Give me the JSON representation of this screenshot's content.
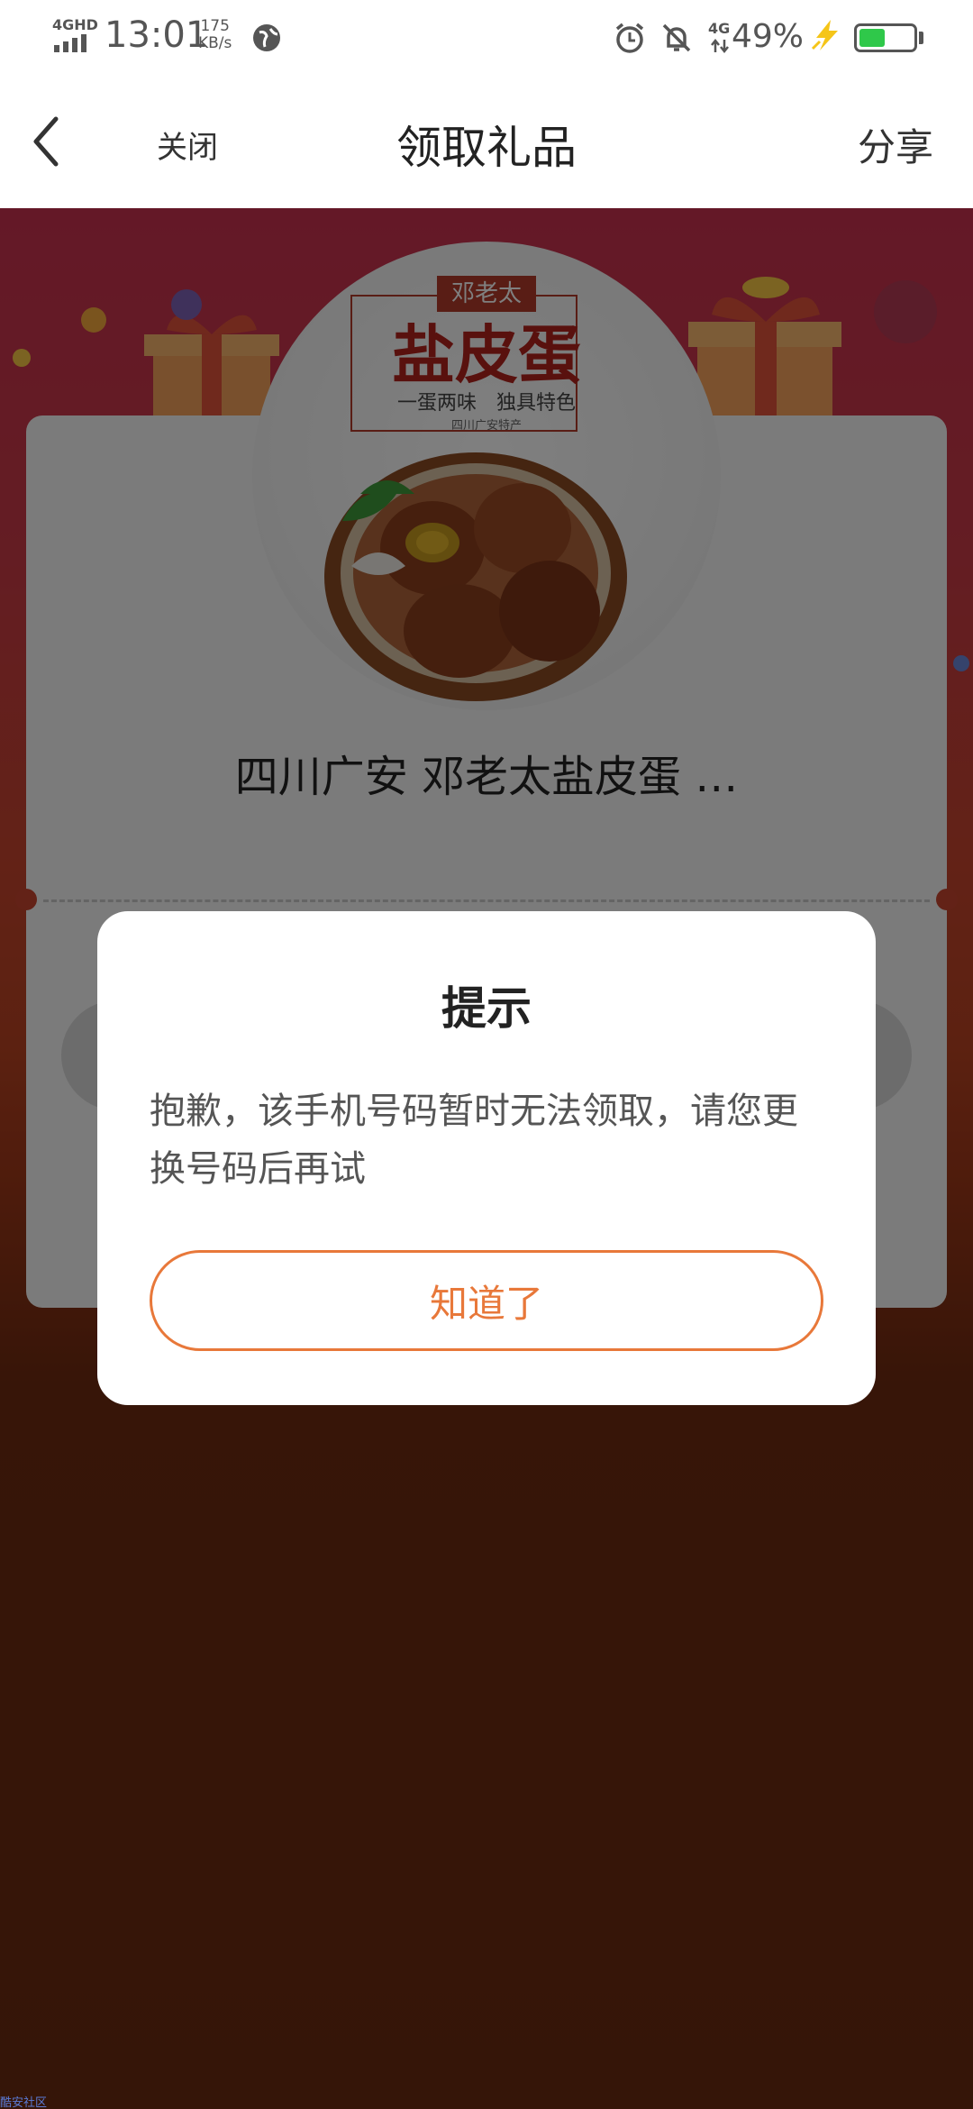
{
  "status_bar": {
    "network": "4GHD",
    "time": "13:01",
    "speed_value": "175",
    "speed_unit": "KB/s",
    "data_type": "4G",
    "battery_percent": "49%",
    "battery_level": 0.49,
    "battery_color": "#2fc84a"
  },
  "nav": {
    "back_icon": "chevron-left-icon",
    "close_label": "关闭",
    "title": "领取礼品",
    "share_label": "分享"
  },
  "product": {
    "brand": "邓老太",
    "name_art": "盐皮蛋",
    "slogan": "一蛋两味　独具特色",
    "origin": "四川广安特产",
    "title": "四川广安 邓老太盐皮蛋 …"
  },
  "dialog": {
    "title": "提示",
    "message": "抱歉，该手机号码暂时无法领取，请您更换号码后再试",
    "confirm_label": "知道了",
    "accent_color": "#e8783a"
  },
  "footer": {
    "watermark": "酷安社区"
  }
}
